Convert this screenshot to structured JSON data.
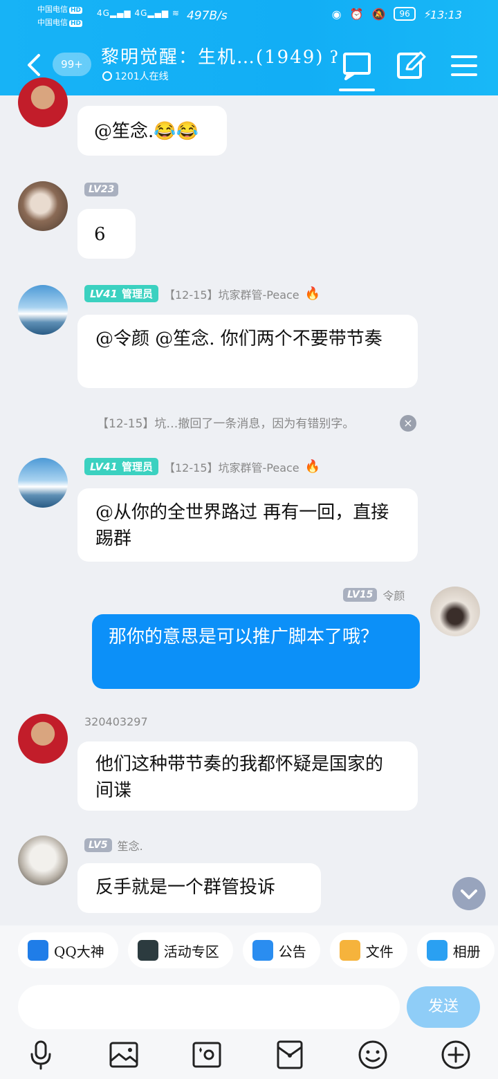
{
  "status": {
    "carrier1": "中国电信",
    "carrier2": "中国电信",
    "hd": "HD",
    "network": "4G",
    "speed": "497B/s",
    "battery": "96",
    "time": "13:13"
  },
  "header": {
    "badge": "99+",
    "title": "黎明觉醒：生机…(1949)",
    "online": "1201人在线"
  },
  "messages": [
    {
      "id": "m1",
      "text": "@笙念.😂😂"
    },
    {
      "id": "m2",
      "level": "LV23",
      "text": "6"
    },
    {
      "id": "m3",
      "level": "LV41",
      "role": "管理员",
      "name": "【12-15】坑家群管-Peace",
      "text": "@令颜 @笙念. 你们两个不要带节奏"
    },
    {
      "id": "m4",
      "level": "LV41",
      "role": "管理员",
      "name": "【12-15】坑家群管-Peace",
      "text": "@从你的全世界路过 再有一回，直接踢群"
    },
    {
      "id": "m5",
      "level": "LV15",
      "name": "令颜",
      "text": "那你的意思是可以推广脚本了哦？",
      "self": true
    },
    {
      "id": "m6",
      "name": "320403297",
      "text": "他们这种带节奏的我都怀疑是国家的间谍"
    },
    {
      "id": "m7",
      "level": "LV5",
      "name": "笙念.",
      "text": "反手就是一个群管投诉"
    }
  ],
  "notice": "【12-15】坑…撤回了一条消息，因为有错别字。",
  "apps": [
    "QQ大神",
    "活动专区",
    "公告",
    "文件",
    "相册"
  ],
  "input": {
    "placeholder": "",
    "send_label": "发送"
  },
  "colors": {
    "brand": "#12aef5",
    "self_bubble": "#0c90f8",
    "admin_tag": "#3bd1c0",
    "level_tag": "#a9b0bf"
  }
}
